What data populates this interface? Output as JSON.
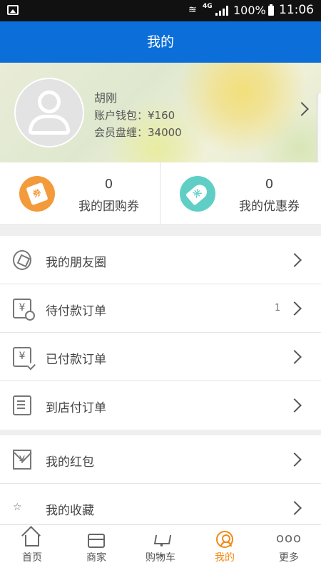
{
  "status_bar": {
    "network": "4G",
    "battery": "100%",
    "time": "11:06"
  },
  "header": {
    "title": "我的"
  },
  "profile": {
    "name": "胡刚",
    "wallet": "账户钱包：¥160",
    "points": "会员盘缠：34000"
  },
  "coupons": [
    {
      "count": "0",
      "label": "我的团购券",
      "icon": "group-coupon-icon",
      "color": "#f39a3a",
      "icon_text": "券"
    },
    {
      "count": "0",
      "label": "我的优惠券",
      "icon": "discount-tag-icon",
      "color": "#5fcfc5",
      "icon_text": "米"
    }
  ],
  "menu_group1": [
    {
      "label": "我的朋友圈",
      "icon": "aperture-icon",
      "badge": ""
    },
    {
      "label": "待付款订单",
      "icon": "pending-payment-icon",
      "badge": "1",
      "icon_text": "¥"
    },
    {
      "label": "已付款订单",
      "icon": "paid-order-icon",
      "badge": "",
      "icon_text": "¥"
    },
    {
      "label": "到店付订单",
      "icon": "list-doc-icon",
      "badge": ""
    }
  ],
  "menu_group2": [
    {
      "label": "我的红包",
      "icon": "red-packet-icon",
      "badge": "",
      "icon_text": "¥"
    },
    {
      "label": "我的收藏",
      "icon": "star-icon",
      "badge": "",
      "icon_text": "☆"
    }
  ],
  "bottom_nav": [
    {
      "label": "首页",
      "icon": "home-icon",
      "active": false
    },
    {
      "label": "商家",
      "icon": "shop-icon",
      "active": false
    },
    {
      "label": "购物车",
      "icon": "cart-icon",
      "active": false
    },
    {
      "label": "我的",
      "icon": "profile-icon",
      "active": true
    },
    {
      "label": "更多",
      "icon": "more-icon",
      "active": false,
      "icon_text": "ooo"
    }
  ],
  "colors": {
    "header_bg": "#0c6fd9",
    "active_tab": "#f08a19"
  }
}
